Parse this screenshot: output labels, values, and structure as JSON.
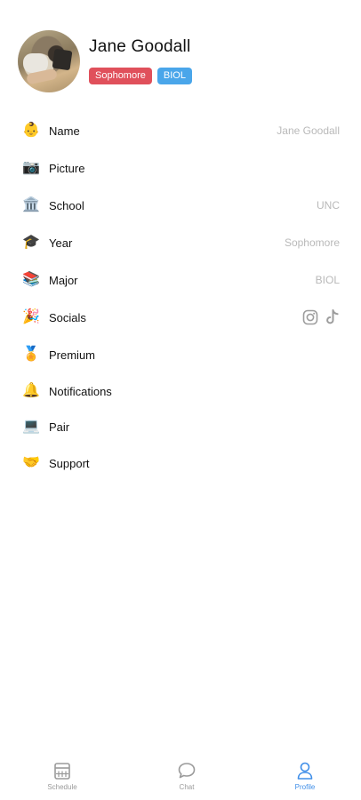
{
  "profile": {
    "name": "Jane Goodall",
    "badges": [
      {
        "label": "Sophomore",
        "color": "#e0505b"
      },
      {
        "label": "BIOL",
        "color": "#4aa6ea"
      }
    ]
  },
  "rows": [
    {
      "emoji": "👶",
      "icon": "baby-face-icon",
      "label": "Name",
      "value": "Jane Goodall"
    },
    {
      "emoji": "📷",
      "icon": "camera-icon",
      "label": "Picture",
      "value": ""
    },
    {
      "emoji": "🏛️",
      "icon": "classical-building-icon",
      "label": "School",
      "value": "UNC"
    },
    {
      "emoji": "🎓",
      "icon": "graduation-cap-icon",
      "label": "Year",
      "value": "Sophomore"
    },
    {
      "emoji": "📚",
      "icon": "books-icon",
      "label": "Major",
      "value": "BIOL"
    },
    {
      "emoji": "🎉",
      "icon": "party-popper-icon",
      "label": "Socials",
      "value": ""
    },
    {
      "emoji": "🏅",
      "icon": "medal-icon",
      "label": "Premium",
      "value": ""
    },
    {
      "emoji": "🔔",
      "icon": "bell-icon",
      "label": "Notifications",
      "value": ""
    },
    {
      "emoji": "💻",
      "icon": "laptop-icon",
      "label": "Pair",
      "value": ""
    },
    {
      "emoji": "🤝",
      "icon": "handshake-icon",
      "label": "Support",
      "value": ""
    }
  ],
  "socials": [
    {
      "icon": "instagram-icon"
    },
    {
      "icon": "tiktok-icon"
    }
  ],
  "tabs": [
    {
      "label": "Schedule",
      "icon": "calendar-icon",
      "active": false
    },
    {
      "label": "Chat",
      "icon": "chat-bubble-icon",
      "active": false
    },
    {
      "label": "Profile",
      "icon": "person-icon",
      "active": true
    }
  ],
  "colors": {
    "accent": "#3f8ee8",
    "value_text": "#b9b9b9",
    "inactive_tab": "#9a9a9a"
  }
}
